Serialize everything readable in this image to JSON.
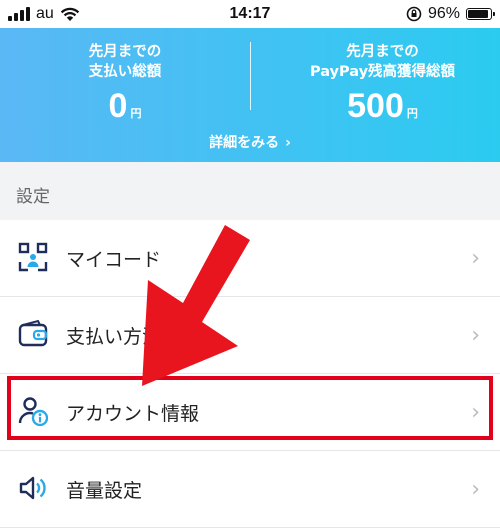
{
  "status_bar": {
    "carrier": "au",
    "time": "14:17",
    "battery": "96%",
    "battery_level": 0.96
  },
  "header": {
    "left_label_1": "先月までの",
    "left_label_2": "支払い総額",
    "left_amount": "0",
    "left_unit": "円",
    "right_label_1": "先月までの",
    "right_label_2": "PayPay残高獲得総額",
    "right_amount": "500",
    "right_unit": "円",
    "details_link": "詳細をみる",
    "details_chevron": "›"
  },
  "section": {
    "title": "設定"
  },
  "settings": {
    "items": [
      {
        "label": "マイコード",
        "icon": "qr-code-icon"
      },
      {
        "label": "支払い方法",
        "icon": "wallet-icon"
      },
      {
        "label": "アカウント情報",
        "icon": "account-info-icon"
      },
      {
        "label": "音量設定",
        "icon": "volume-icon"
      }
    ],
    "chevron": "›"
  },
  "annotation": {
    "arrow_color": "#e8141e",
    "highlight_color": "#e3001b",
    "highlighted_item": "アカウント情報"
  },
  "colors": {
    "header_start": "#5ab8f5",
    "header_end": "#2bcbf0",
    "icon_navy": "#1f2d5a",
    "icon_blue": "#2aa9e8"
  }
}
